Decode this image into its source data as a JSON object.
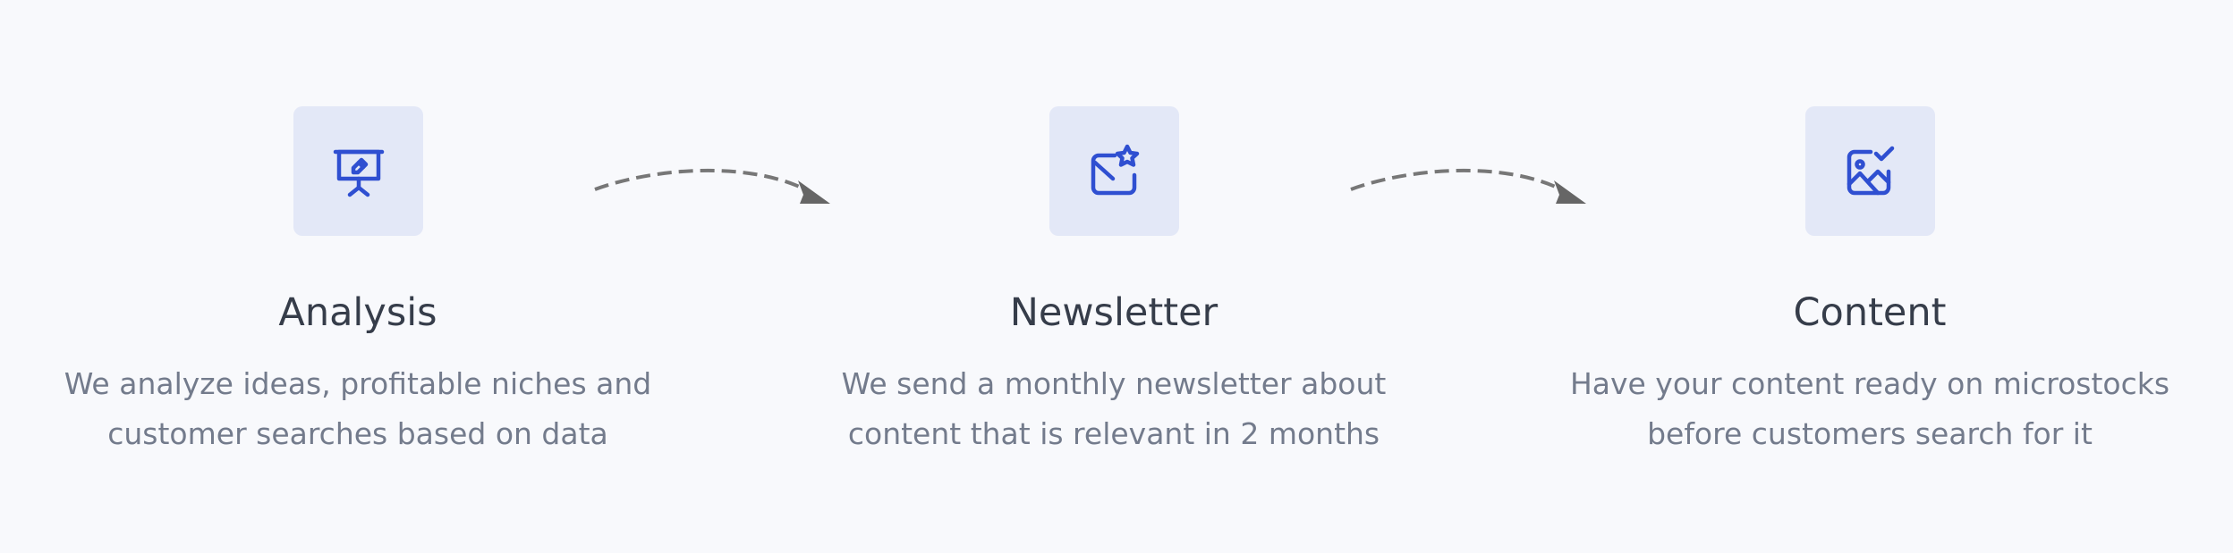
{
  "colors": {
    "background": "#f8f9fc",
    "icon_tile": "#e3e8f7",
    "icon_stroke": "#2f4fd1",
    "title": "#363d4a",
    "description": "#737b8c",
    "arrow": "#777777"
  },
  "steps": [
    {
      "icon": "presentation-board-icon",
      "title": "Analysis",
      "description": "We analyze ideas, profitable niches and customer searches based on data"
    },
    {
      "icon": "mail-star-icon",
      "title": "Newsletter",
      "description": "We send a monthly newsletter about content that is relevant in 2 months"
    },
    {
      "icon": "image-check-icon",
      "title": "Content",
      "description": "Have your content ready on microstocks before customers search for it"
    }
  ],
  "connectors": [
    "dashed-curved-arrow-icon",
    "dashed-curved-arrow-icon"
  ]
}
